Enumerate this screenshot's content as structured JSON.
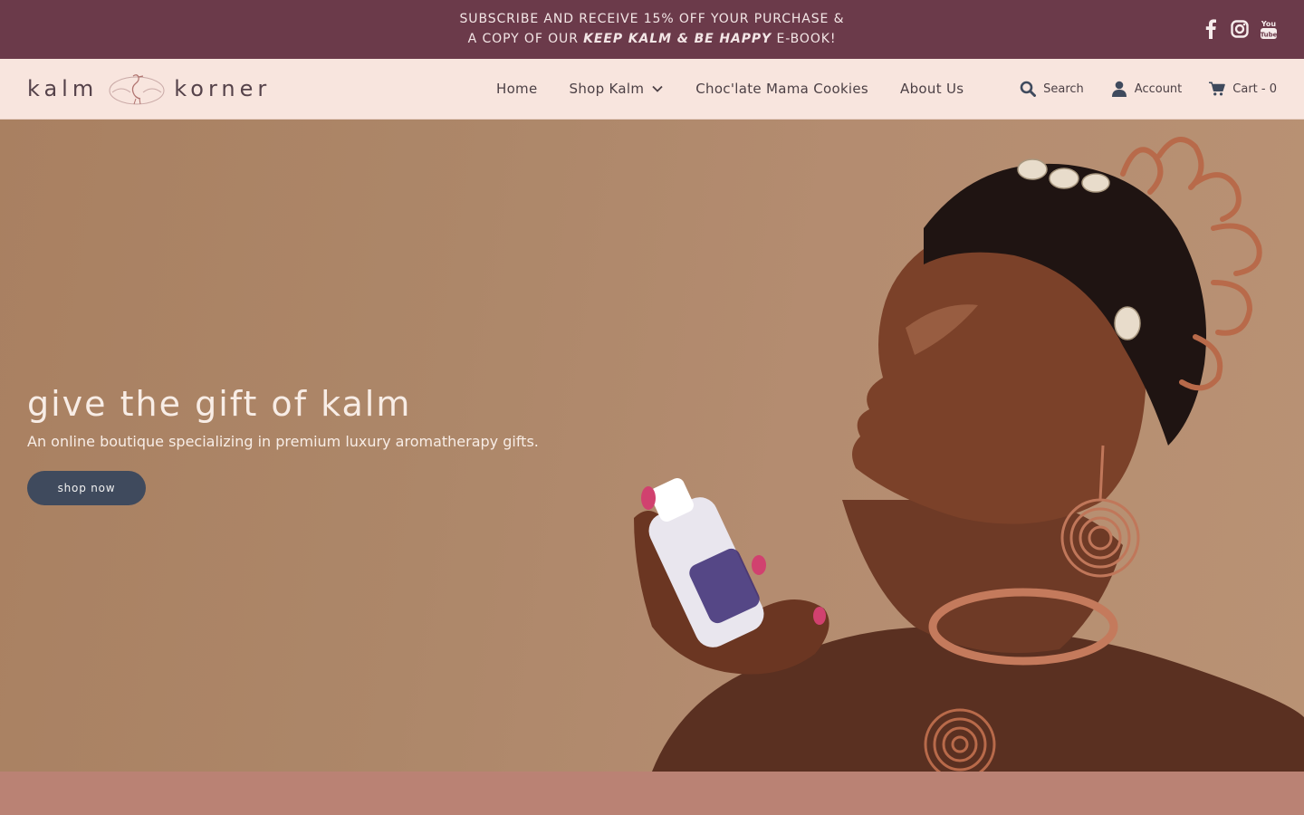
{
  "announcement": {
    "line1": "SUBSCRIBE AND RECEIVE 15% OFF YOUR PURCHASE &",
    "line2_prefix": "A COPY OF OUR ",
    "line2_emphasis": "KEEP KALM & BE HAPPY",
    "line2_suffix": " E-BOOK!"
  },
  "social": [
    {
      "icon": "facebook-icon"
    },
    {
      "icon": "instagram-icon"
    },
    {
      "icon": "youtube-icon",
      "label_top": "You",
      "label_bottom": "Tube"
    }
  ],
  "logo": {
    "left": "kalm",
    "right": "korner"
  },
  "nav": {
    "items": [
      {
        "label": "Home"
      },
      {
        "label": "Shop Kalm",
        "has_dropdown": true
      },
      {
        "label": "Choc'late Mama Cookies"
      },
      {
        "label": "About Us"
      }
    ]
  },
  "utilities": {
    "search": "Search",
    "account": "Account",
    "cart": "Cart - 0"
  },
  "hero": {
    "title": "give the gift of kalm",
    "subtitle": "An online boutique specializing in premium luxury aromatherapy gifts.",
    "button": "shop now"
  },
  "colors": {
    "announcement_bg": "#6b3a4a",
    "header_bg": "#f8e5de",
    "hero_bg": "#ad8769",
    "button_bg": "#3f4a5d",
    "footer_band": "#ba8274"
  }
}
